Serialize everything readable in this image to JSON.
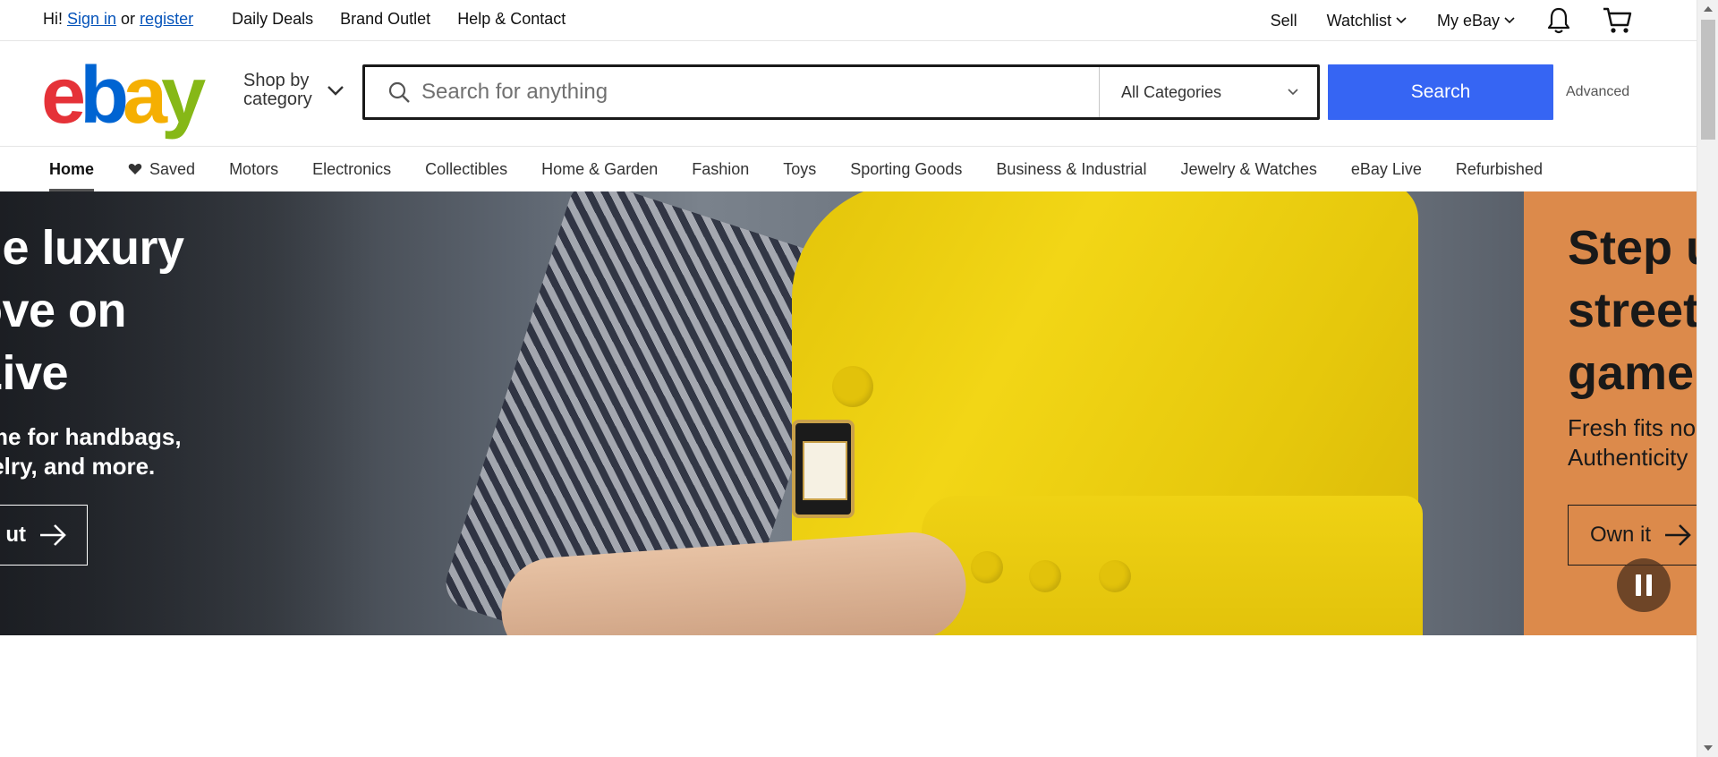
{
  "topbar": {
    "greeting": "Hi!",
    "sign_in": "Sign in",
    "or": "or",
    "register": "register",
    "links": [
      "Daily Deals",
      "Brand Outlet",
      "Help & Contact"
    ],
    "sell": "Sell",
    "watchlist": "Watchlist",
    "my_ebay": "My eBay",
    "icons": [
      "bell-icon",
      "cart-icon"
    ]
  },
  "header": {
    "logo": {
      "e1": "e",
      "b": "b",
      "a": "a",
      "y": "y"
    },
    "shop_by_line1": "Shop by",
    "shop_by_line2": "category",
    "search_placeholder": "Search for anything",
    "category_selected": "All Categories",
    "search_button": "Search",
    "advanced": "Advanced"
  },
  "catnav": {
    "items": [
      "Home",
      "Saved",
      "Motors",
      "Electronics",
      "Collectibles",
      "Home & Garden",
      "Fashion",
      "Toys",
      "Sporting Goods",
      "Business & Industrial",
      "Jewelry & Watches",
      "eBay Live",
      "Refurbished"
    ],
    "active": "Home"
  },
  "hero": {
    "slide1": {
      "line1": "he luxury",
      "line2": "ove on",
      "line3": "Live",
      "sub1": " time for handbags,",
      "sub2": "welry, and more.",
      "cta": "ut"
    },
    "slide2": {
      "line1": "Step u",
      "line2": "street",
      "line3": "game",
      "sub1": "Fresh fits no",
      "sub2": "Authenticity",
      "cta": "Own it"
    },
    "colors": {
      "slide2_bg": "#dc8a4b",
      "search_button": "#3665f3"
    }
  }
}
